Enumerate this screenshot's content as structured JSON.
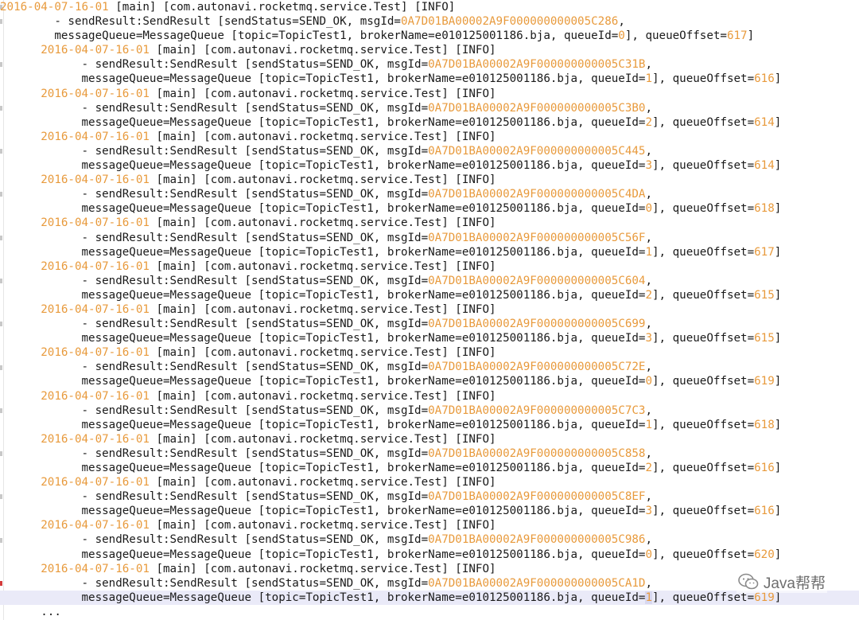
{
  "log": {
    "first": {
      "timestamp": "2016-04-07-16-01",
      "thread": "[main]",
      "logger": "[com.autonavi.rocketmq.service.Test]",
      "level": "[INFO]",
      "msgId": "0A7D01BA00002A9F000000000005C286",
      "queueId": "0",
      "queueOffset": "617"
    },
    "entries": [
      {
        "timestamp": "2016-04-07-16-01",
        "msgId": "0A7D01BA00002A9F000000000005C31B",
        "queueId": "1",
        "queueOffset": "616"
      },
      {
        "timestamp": "2016-04-07-16-01",
        "msgId": "0A7D01BA00002A9F000000000005C3B0",
        "queueId": "2",
        "queueOffset": "614"
      },
      {
        "timestamp": "2016-04-07-16-01",
        "msgId": "0A7D01BA00002A9F000000000005C445",
        "queueId": "3",
        "queueOffset": "614"
      },
      {
        "timestamp": "2016-04-07-16-01",
        "msgId": "0A7D01BA00002A9F000000000005C4DA",
        "queueId": "0",
        "queueOffset": "618"
      },
      {
        "timestamp": "2016-04-07-16-01",
        "msgId": "0A7D01BA00002A9F000000000005C56F",
        "queueId": "1",
        "queueOffset": "617"
      },
      {
        "timestamp": "2016-04-07-16-01",
        "msgId": "0A7D01BA00002A9F000000000005C604",
        "queueId": "2",
        "queueOffset": "615"
      },
      {
        "timestamp": "2016-04-07-16-01",
        "msgId": "0A7D01BA00002A9F000000000005C699",
        "queueId": "3",
        "queueOffset": "615"
      },
      {
        "timestamp": "2016-04-07-16-01",
        "msgId": "0A7D01BA00002A9F000000000005C72E",
        "queueId": "0",
        "queueOffset": "619"
      },
      {
        "timestamp": "2016-04-07-16-01",
        "msgId": "0A7D01BA00002A9F000000000005C7C3",
        "queueId": "1",
        "queueOffset": "618"
      },
      {
        "timestamp": "2016-04-07-16-01",
        "msgId": "0A7D01BA00002A9F000000000005C858",
        "queueId": "2",
        "queueOffset": "616"
      },
      {
        "timestamp": "2016-04-07-16-01",
        "msgId": "0A7D01BA00002A9F000000000005C8EF",
        "queueId": "3",
        "queueOffset": "616"
      },
      {
        "timestamp": "2016-04-07-16-01",
        "msgId": "0A7D01BA00002A9F000000000005C986",
        "queueId": "0",
        "queueOffset": "620"
      },
      {
        "timestamp": "2016-04-07-16-01",
        "msgId": "0A7D01BA00002A9F000000000005CA1D",
        "queueId": "1",
        "queueOffset": "619"
      }
    ],
    "header_rest": "[main] [com.autonavi.rocketmq.service.Test] [INFO]",
    "send_prefix": "- sendResult:SendResult [sendStatus=SEND_OK, msgId=",
    "queue_prefix": "messageQueue=MessageQueue [topic=TopicTest1, brokerName=e010125001186.bja, queueId=",
    "queue_offset_label": "], queueOffset=",
    "ellipsis": "..."
  },
  "watermark": {
    "text": "Java帮帮",
    "icon": "wechat-icon",
    "colors": {
      "text": "#6e6e6e"
    }
  },
  "colors": {
    "timestamp": "#e89a3c",
    "number": "#e89a3c",
    "text": "#1a1a1a",
    "highlight_line": "#eaeaf8",
    "gutter_marker_red": "#d43c3c"
  }
}
